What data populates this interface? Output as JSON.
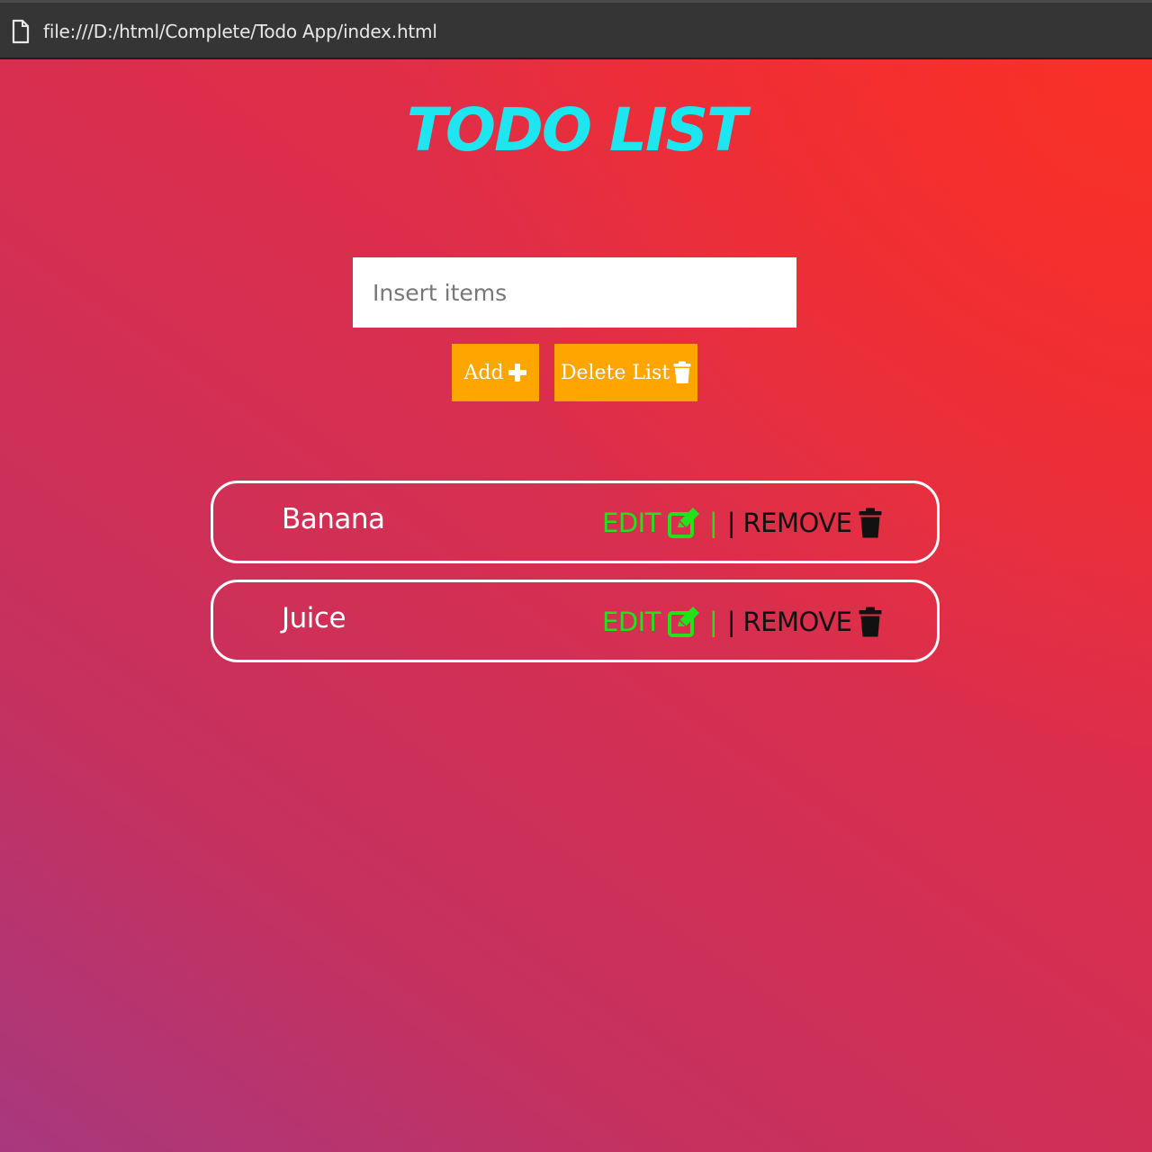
{
  "browser": {
    "url": "file:///D:/html/Complete/Todo App/index.html"
  },
  "app": {
    "title": "TODO LIST",
    "input": {
      "placeholder": "Insert items",
      "value": ""
    },
    "buttons": {
      "add_label": "Add",
      "delete_label": "Delete List"
    },
    "items": [
      {
        "label": "Banana",
        "edit_label": "EDIT",
        "separator": "|",
        "separator2": "|",
        "remove_label": "REMOVE"
      },
      {
        "label": "Juice",
        "edit_label": "EDIT",
        "separator": "|",
        "separator2": "|",
        "remove_label": "REMOVE"
      }
    ]
  },
  "colors": {
    "title": "#1de6f0",
    "button_bg": "#ffa500",
    "edit": "#22e21e",
    "remove": "#111111"
  },
  "icons": [
    "page-icon",
    "plus-icon",
    "trash-icon",
    "edit-icon"
  ]
}
